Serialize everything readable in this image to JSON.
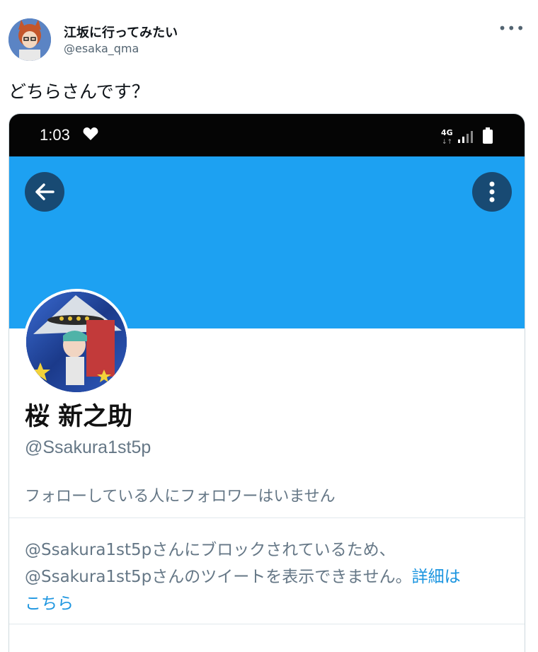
{
  "tweet": {
    "author_name": "江坂に行ってみたい",
    "author_handle": "@esaka_qma",
    "more_label": "•••",
    "text": "どちらさんです？"
  },
  "screenshot": {
    "status_bar": {
      "time": "1:03",
      "network": "4G"
    },
    "profile": {
      "display_name": "桜 新之助",
      "screen_name": "@Ssakura1st5p",
      "follow_note": "フォローしている人にフォロワーはいません",
      "blocked_line1": "@Ssakura1st5pさんにブロックされているため、",
      "blocked_line2": "@Ssakura1st5pさんのツイートを表示できません。",
      "details_link_a": "詳細は",
      "details_link_b": "こちら"
    },
    "colors": {
      "banner": "#1da1f2",
      "button_bg": "#184a73",
      "link": "#1b95e0"
    }
  }
}
